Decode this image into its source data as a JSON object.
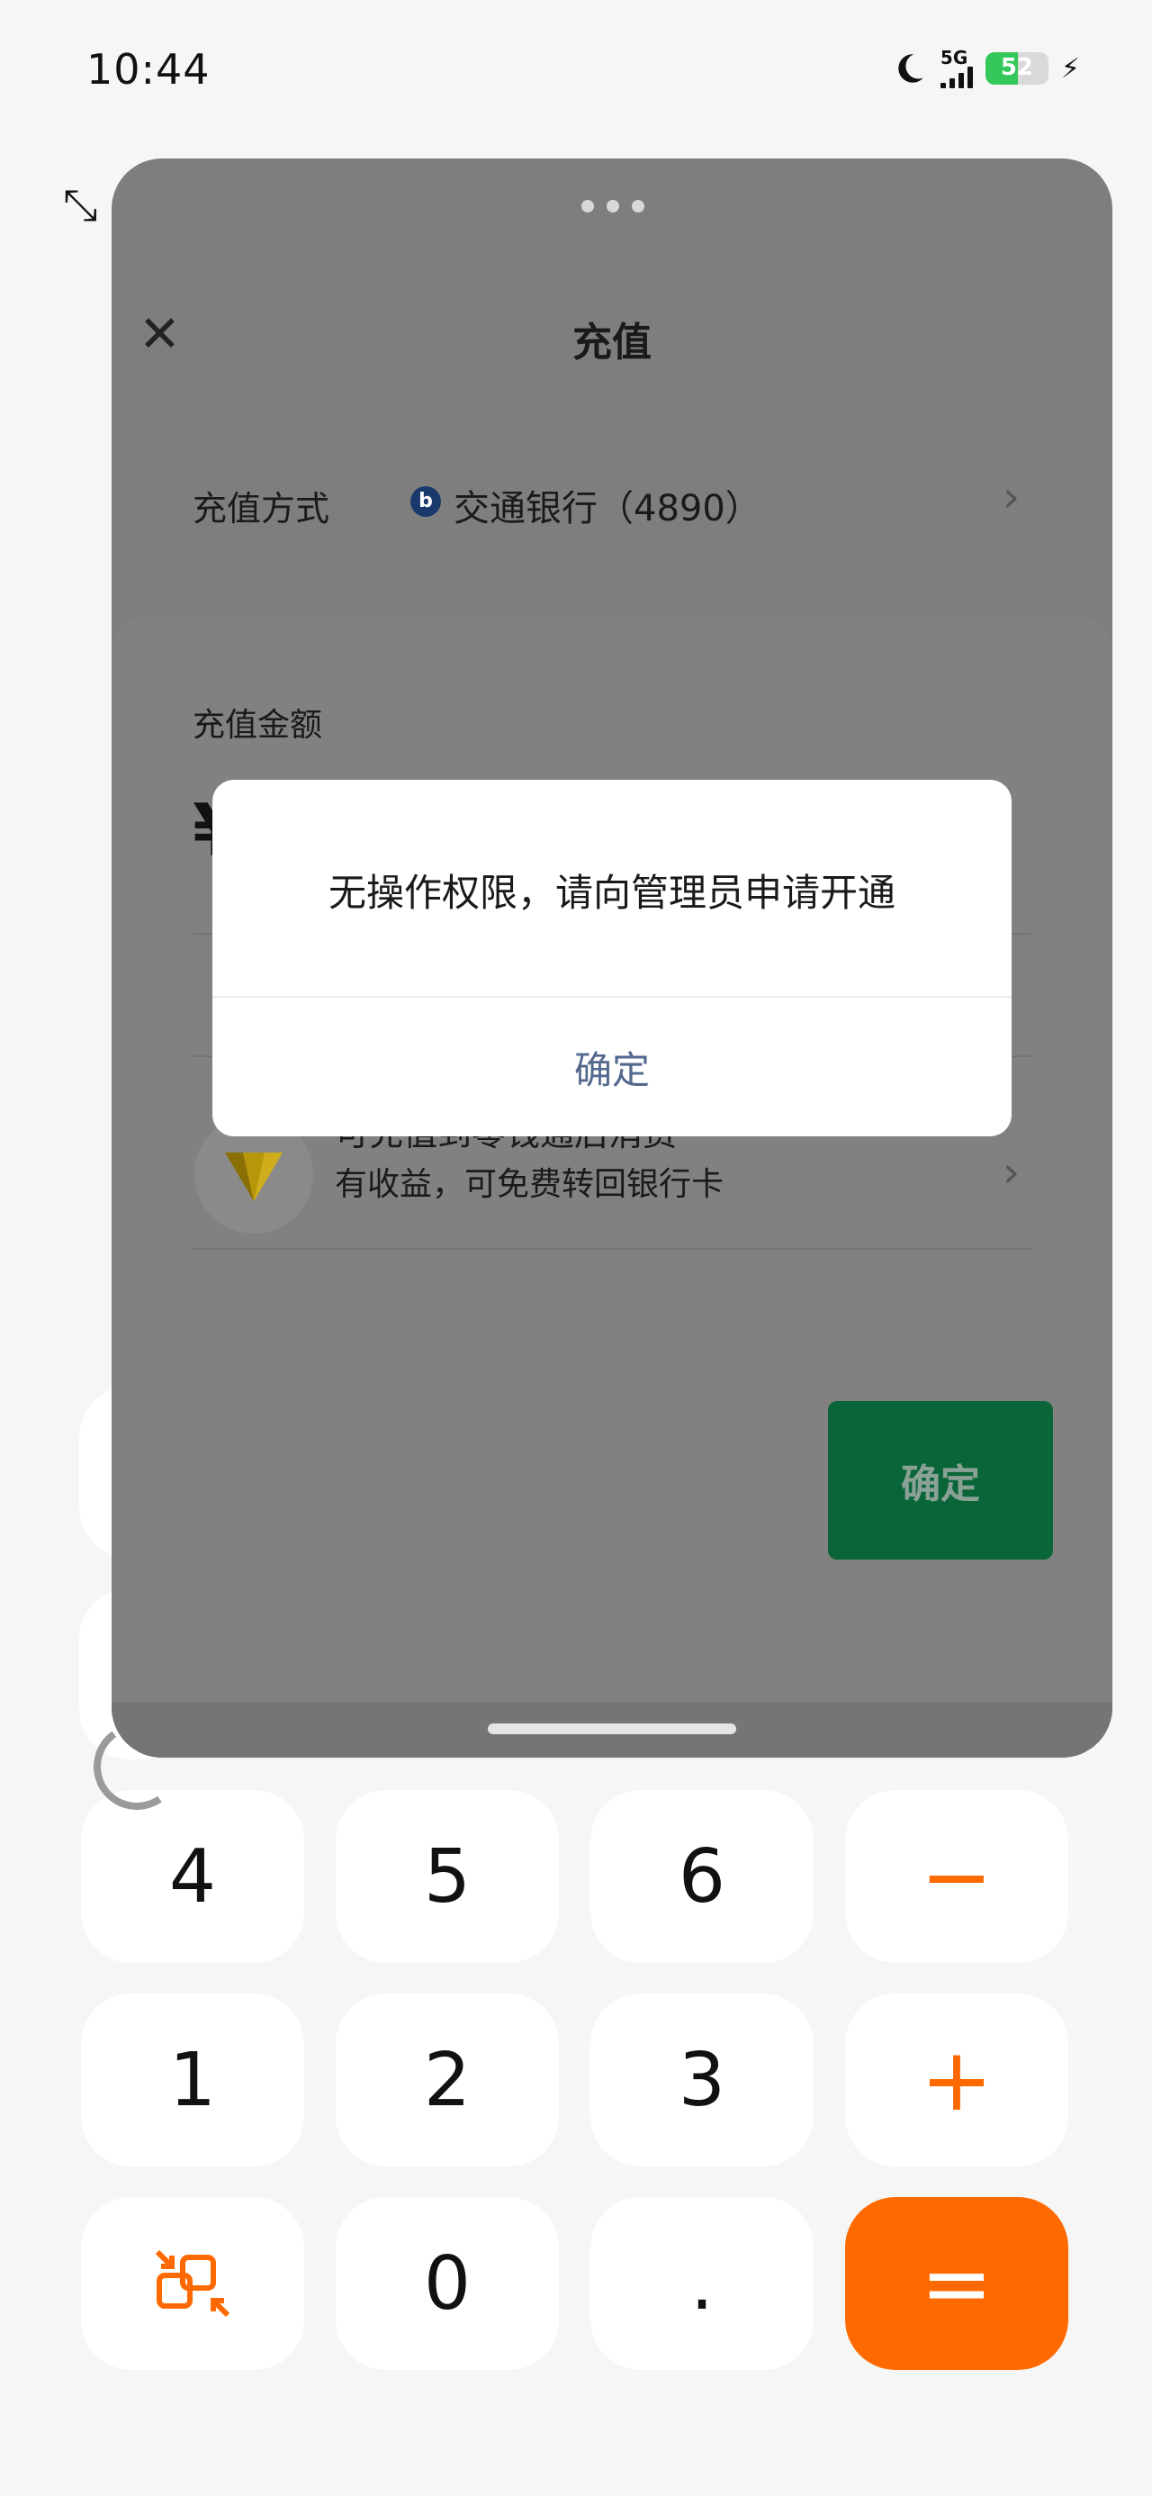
{
  "status_bar": {
    "time": "10:44",
    "network": "5G",
    "battery": "52"
  },
  "background_calc": {
    "keys_row1": [
      "4",
      "5",
      "6",
      "−"
    ],
    "keys_row2": [
      "1",
      "2",
      "3",
      "+"
    ],
    "keys_row3": [
      "⇄",
      "0",
      ".",
      "="
    ]
  },
  "sheet": {
    "title": "充值",
    "method_label": "充值方式",
    "bank": "交通银行（4890）",
    "amount_label": "充值金额",
    "currency_symbol": "¥",
    "promo_title": "可充值到零钱通后消费",
    "promo_subtitle": "有收益，可免费转回银行卡",
    "confirm_label": "确定"
  },
  "dialog": {
    "message": "无操作权限，请向管理员申请开通",
    "button": "确定"
  },
  "colors": {
    "accent_orange": "#ff6a00",
    "confirm_green": "#0a6538",
    "dialog_link": "#54698e"
  }
}
